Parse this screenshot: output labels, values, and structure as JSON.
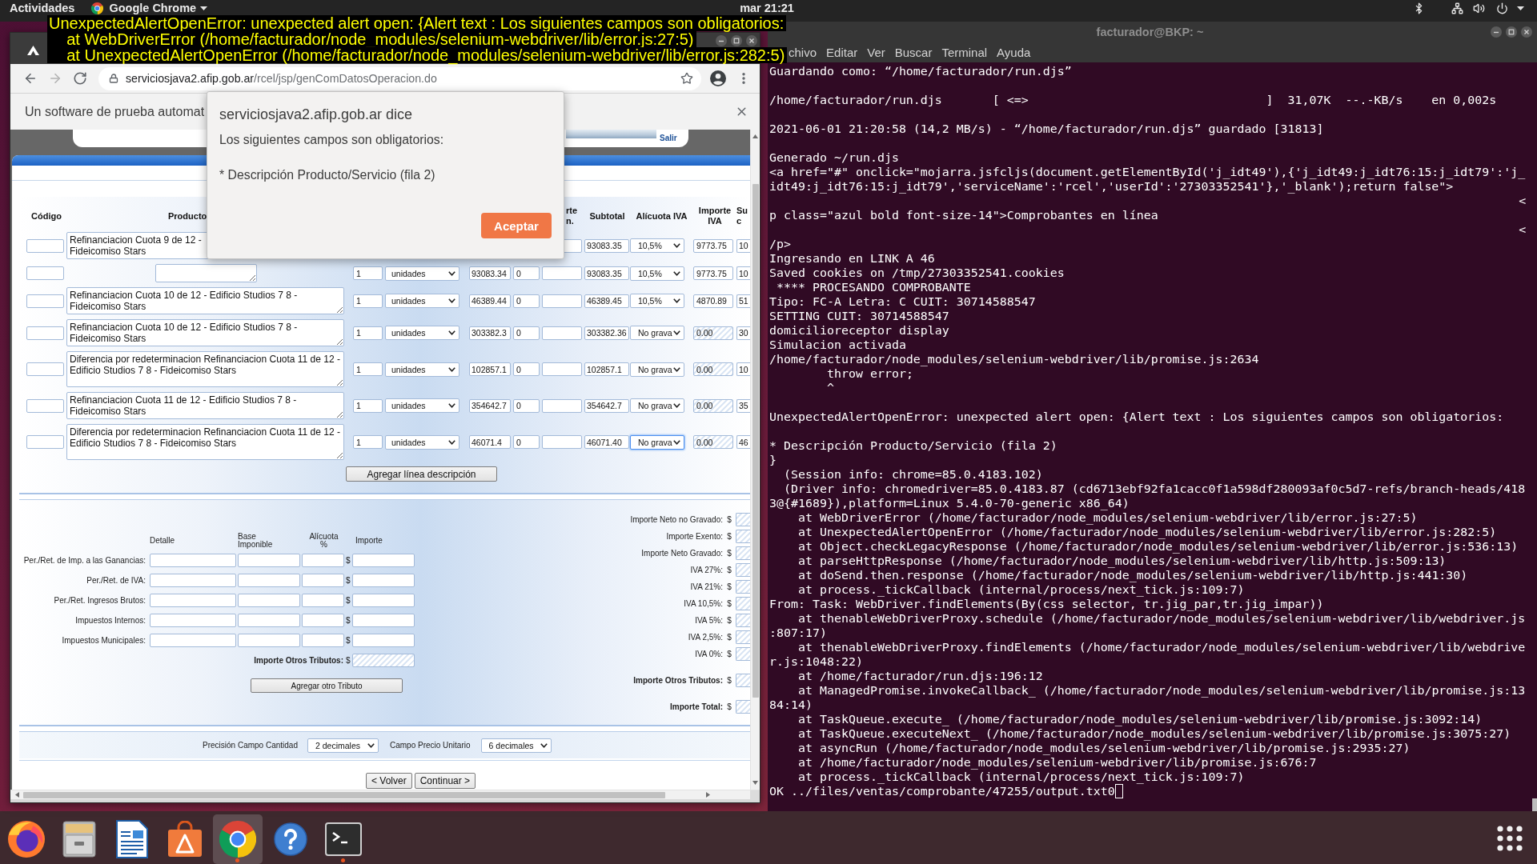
{
  "top_bar": {
    "activities": "Actividades",
    "app_menu": "Google Chrome",
    "clock": "mar 21:21"
  },
  "error_overlay": {
    "lines": [
      "UnexpectedAlertOpenError: unexpected alert open: {Alert text : Los siguientes campos son obligatorios:",
      "    at WebDriverError (/home/facturador/node_modules/selenium-webdriver/lib/error.js:27:5)",
      "    at UnexpectedAlertOpenError (/home/facturador/node_modules/selenium-webdriver/lib/error.js:282:5)"
    ]
  },
  "browser": {
    "nav_buttons": [
      {
        "kind": "back",
        "disabled": false
      },
      {
        "kind": "forward",
        "disabled": true
      },
      {
        "kind": "reload",
        "disabled": false
      }
    ],
    "address": {
      "host": "serviciosjava2.afip.gob.ar",
      "path": "/rcel/jsp/genComDatosOperacion.do"
    },
    "infobar": "Un software de prueba automat",
    "page": {
      "logout_link": "Salir",
      "items": {
        "header": {
          "codigo": [
            "Código"
          ],
          "producto": [
            "Producto"
          ],
          "column_7": [
            "rte",
            "n."
          ],
          "subtotal": [
            "Subtotal"
          ],
          "alicuota_iva": [
            "Alícuota IVA"
          ],
          "importe_iva": [
            "Importe",
            "IVA"
          ],
          "column_11": [
            "Su",
            "c"
          ]
        },
        "rows": [
          {
            "producto": "Refinanciacion Cuota 9 de 12 -\nFideicomiso Stars",
            "subtotal": "93083.35",
            "alicuota_iva": "10,5%",
            "alicuota_focused": false,
            "importe_iva": "9773.75",
            "importe_iva_disabled": false,
            "column_11": "10"
          },
          {
            "column_3": "1",
            "column_4": "unidades",
            "column_5": "93083.34",
            "column_6": "0",
            "subtotal": "93083.35",
            "alicuota_iva": "10,5%",
            "alicuota_focused": false,
            "importe_iva": "9773.75",
            "importe_iva_disabled": false,
            "column_11": "10"
          },
          {
            "producto": "Refinanciacion Cuota 10 de 12 - Edificio Studios 7 8 - Fideicomiso Stars",
            "column_3": "1",
            "column_4": "unidades",
            "column_5": "46389.44",
            "column_6": "0",
            "subtotal": "46389.45",
            "alicuota_iva": "10,5%",
            "alicuota_focused": false,
            "importe_iva": "4870.89",
            "importe_iva_disabled": false,
            "column_11": "51"
          },
          {
            "producto": "Refinanciacion Cuota 10 de 12 - Edificio Studios 7 8 - Fideicomiso Stars",
            "column_3": "1",
            "column_4": "unidades",
            "column_5": "303382.3",
            "column_6": "0",
            "subtotal": "303382.36",
            "alicuota_iva": "No grava",
            "alicuota_focused": false,
            "importe_iva": "0.00",
            "importe_iva_disabled": true,
            "column_11": "30"
          },
          {
            "producto": "Diferencia por redeterminacion Refinanciacion Cuota 11 de 12 - Edificio Studios 7 8 - Fideicomiso Stars",
            "column_3": "1",
            "column_4": "unidades",
            "column_5": "102857.1",
            "column_6": "0",
            "subtotal": "102857.1",
            "alicuota_iva": "No grava",
            "alicuota_focused": false,
            "importe_iva": "0.00",
            "importe_iva_disabled": true,
            "column_11": "10"
          },
          {
            "producto": "Refinanciacion Cuota 11 de 12 - Edificio Studios 7 8 - Fideicomiso Stars",
            "column_3": "1",
            "column_4": "unidades",
            "column_5": "354642.7",
            "column_6": "0",
            "subtotal": "354642.7",
            "alicuota_iva": "No grava",
            "alicuota_focused": false,
            "importe_iva": "0.00",
            "importe_iva_disabled": true,
            "column_11": "35"
          },
          {
            "producto": "Diferencia por redeterminacion Refinanciacion Cuota 11 de 12 - Edificio Studios 7 8 - Fideicomiso Stars",
            "column_3": "1",
            "column_4": "unidades",
            "column_5": "46071.4",
            "column_6": "0",
            "subtotal": "46071.40",
            "alicuota_iva": "No grava",
            "alicuota_focused": true,
            "importe_iva": "0.00",
            "importe_iva_disabled": true,
            "column_11": "46"
          }
        ],
        "add_button": "Agregar línea descripción"
      },
      "other_taxes": {
        "header": {
          "detalle": [
            "Detalle"
          ],
          "base": [
            "Base",
            "Imponible"
          ],
          "alicuota": [
            "Alícuota",
            "%"
          ],
          "importe": [
            "Importe"
          ]
        },
        "rows": [
          {
            "label": "Per./Ret. de Imp. a las Ganancias:",
            "currency": "$"
          },
          {
            "label": "Per./Ret. de IVA:",
            "currency": "$"
          },
          {
            "label": "Per./Ret. Ingresos Brutos:",
            "currency": "$"
          },
          {
            "label": "Impuestos Internos:",
            "currency": "$"
          },
          {
            "label": "Impuestos Municipales:",
            "currency": "$"
          }
        ],
        "total": {
          "label": "Importe Otros Tributos:",
          "currency": "$"
        },
        "add_button": "Agregar otro Tributo"
      },
      "totals": [
        {
          "kind": "line",
          "label": "Importe Neto no Gravado:",
          "currency": "$"
        },
        {
          "kind": "line",
          "label": "Importe Exento:",
          "currency": "$"
        },
        {
          "kind": "line",
          "label": "Importe Neto Gravado:",
          "currency": "$"
        },
        {
          "kind": "line",
          "label": "IVA 27%:",
          "currency": "$"
        },
        {
          "kind": "line",
          "label": "IVA 21%:",
          "currency": "$"
        },
        {
          "kind": "line",
          "label": "IVA 10,5%:",
          "currency": "$"
        },
        {
          "kind": "line",
          "label": "IVA 5%:",
          "currency": "$"
        },
        {
          "kind": "line",
          "label": "IVA 2,5%:",
          "currency": "$"
        },
        {
          "kind": "line",
          "label": "IVA 0%:",
          "currency": "$"
        },
        {
          "kind": "sum",
          "label": "Importe Otros Tributos:",
          "currency": "$"
        },
        {
          "kind": "sum",
          "label": "Importe Total:",
          "currency": "$"
        }
      ],
      "precision": {
        "quantity": {
          "label": "Precisión Campo Cantidad",
          "value": "2 decimales"
        },
        "unit_price": {
          "label": "Campo Precio Unitario",
          "value": "6 decimales"
        }
      },
      "buttons": [
        "< Volver",
        "Continuar >"
      ]
    },
    "dialog": {
      "title": "serviciosjava2.afip.gob.ar dice",
      "message": "Los siguientes campos son obligatorios:",
      "detail": "* Descripción Producto/Servicio (fila 2)",
      "button": "Aceptar"
    }
  },
  "terminal": {
    "title": "facturador@BKP: ~",
    "menu": [
      "chivo",
      "Editar",
      "Ver",
      "Buscar",
      "Terminal",
      "Ayuda"
    ],
    "lines": [
      {
        "kind": "text",
        "text": "Guardando como: “/home/facturador/run.djs”"
      },
      {
        "kind": "blank"
      },
      {
        "kind": "text",
        "text": "/home/facturador/run.djs       [ <=>                                 ]  31,07K  --.-KB/s    en 0,002s"
      },
      {
        "kind": "blank"
      },
      {
        "kind": "text",
        "text": "2021-06-01 21:20:58 (14,2 MB/s) - “/home/facturador/run.djs” guardado [31813]"
      },
      {
        "kind": "blank"
      },
      {
        "kind": "text",
        "text": "Generado ~/run.djs"
      },
      {
        "kind": "text",
        "text": "<a href=\"#\" onclick=\"mojarra.jsfcljs(document.getElementById('j_idt49'),{'j_idt49:j_idt76:15:j_idt79':'j_idt49:j_idt76:15:j_idt79','serviceName':'rcel','userId':'27303352541'},'_blank');return false\">"
      },
      {
        "kind": "right",
        "text": "<"
      },
      {
        "kind": "text",
        "text": "p class=\"azul bold font-size-14\">Comprobantes en línea"
      },
      {
        "kind": "right",
        "text": "<"
      },
      {
        "kind": "text",
        "text": "/p>"
      },
      {
        "kind": "text",
        "text": "Ingresando en LINK A 46"
      },
      {
        "kind": "text",
        "text": "Saved cookies on /tmp/27303352541.cookies"
      },
      {
        "kind": "text",
        "text": " **** PROCESANDO COMPROBANTE"
      },
      {
        "kind": "text",
        "text": "Tipo: FC-A Letra: C CUIT: 30714588547"
      },
      {
        "kind": "text",
        "text": "SETTING CUIT: 30714588547"
      },
      {
        "kind": "text",
        "text": "domicilioreceptor display"
      },
      {
        "kind": "text",
        "text": "Simulacion activada"
      },
      {
        "kind": "text",
        "text": "/home/facturador/node_modules/selenium-webdriver/lib/promise.js:2634"
      },
      {
        "kind": "text",
        "text": "        throw error;"
      },
      {
        "kind": "text",
        "text": "        ^"
      },
      {
        "kind": "blank"
      },
      {
        "kind": "text",
        "text": "UnexpectedAlertOpenError: unexpected alert open: {Alert text : Los siguientes campos son obligatorios:"
      },
      {
        "kind": "blank"
      },
      {
        "kind": "text",
        "text": "* Descripción Producto/Servicio (fila 2)"
      },
      {
        "kind": "text",
        "text": "}"
      },
      {
        "kind": "text",
        "text": "  (Session info: chrome=85.0.4183.102)"
      },
      {
        "kind": "text",
        "text": "  (Driver info: chromedriver=85.0.4183.87 (cd6713ebf92fa1cacc0f1a598df280093af0c5d7-refs/branch-heads/4183@{#1689}),platform=Linux 5.4.0-70-generic x86_64)"
      },
      {
        "kind": "text",
        "text": "    at WebDriverError (/home/facturador/node_modules/selenium-webdriver/lib/error.js:27:5)"
      },
      {
        "kind": "text",
        "text": "    at UnexpectedAlertOpenError (/home/facturador/node_modules/selenium-webdriver/lib/error.js:282:5)"
      },
      {
        "kind": "text",
        "text": "    at Object.checkLegacyResponse (/home/facturador/node_modules/selenium-webdriver/lib/error.js:536:13)"
      },
      {
        "kind": "text",
        "text": "    at parseHttpResponse (/home/facturador/node_modules/selenium-webdriver/lib/http.js:509:13)"
      },
      {
        "kind": "text",
        "text": "    at doSend.then.response (/home/facturador/node_modules/selenium-webdriver/lib/http.js:441:30)"
      },
      {
        "kind": "text",
        "text": "    at process._tickCallback (internal/process/next_tick.js:109:7)"
      },
      {
        "kind": "text",
        "text": "From: Task: WebDriver.findElements(By(css selector, tr.jig_par,tr.jig_impar))"
      },
      {
        "kind": "text",
        "text": "    at thenableWebDriverProxy.schedule (/home/facturador/node_modules/selenium-webdriver/lib/webdriver.js:807:17)"
      },
      {
        "kind": "text",
        "text": "    at thenableWebDriverProxy.findElements (/home/facturador/node_modules/selenium-webdriver/lib/webdriver.js:1048:22)"
      },
      {
        "kind": "text",
        "text": "    at /home/facturador/run.djs:196:12"
      },
      {
        "kind": "text",
        "text": "    at ManagedPromise.invokeCallback_ (/home/facturador/node_modules/selenium-webdriver/lib/promise.js:1384:14)"
      },
      {
        "kind": "text",
        "text": "    at TaskQueue.execute_ (/home/facturador/node_modules/selenium-webdriver/lib/promise.js:3092:14)"
      },
      {
        "kind": "text",
        "text": "    at TaskQueue.executeNext_ (/home/facturador/node_modules/selenium-webdriver/lib/promise.js:3075:27)"
      },
      {
        "kind": "text",
        "text": "    at asyncRun (/home/facturador/node_modules/selenium-webdriver/lib/promise.js:2935:27)"
      },
      {
        "kind": "text",
        "text": "    at /home/facturador/node_modules/selenium-webdriver/lib/promise.js:676:7"
      },
      {
        "kind": "text",
        "text": "    at process._tickCallback (internal/process/next_tick.js:109:7)"
      },
      {
        "kind": "prompt",
        "text": "OK ../files/ventas/comprobante/47255/output.txt0"
      }
    ]
  },
  "dock": {
    "items": [
      {
        "kind": "fox",
        "selected": false,
        "running": false
      },
      {
        "kind": "cabinet",
        "selected": false,
        "running": false
      },
      {
        "kind": "document",
        "selected": false,
        "running": false
      },
      {
        "kind": "bag",
        "selected": false,
        "running": false
      },
      {
        "kind": "tricolor",
        "selected": true,
        "running": true
      },
      {
        "kind": "help",
        "selected": false,
        "running": false
      },
      {
        "kind": "terminal",
        "selected": false,
        "running": true
      }
    ]
  }
}
